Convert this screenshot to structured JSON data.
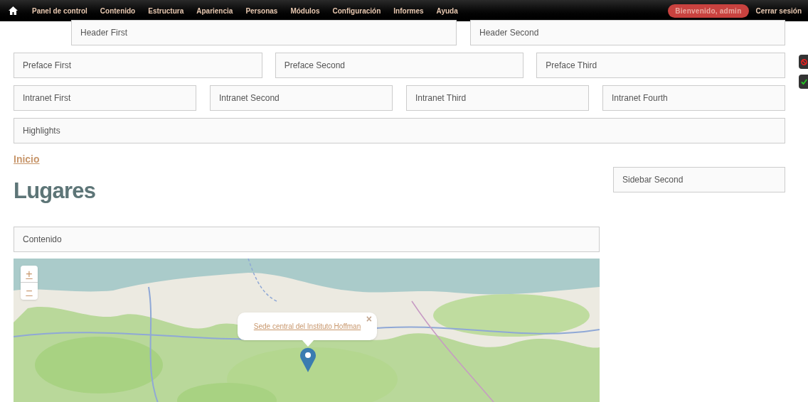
{
  "toolbar": {
    "menu": [
      "Panel de control",
      "Contenido",
      "Estructura",
      "Apariencia",
      "Personas",
      "Módulos",
      "Configuración",
      "Informes",
      "Ayuda"
    ],
    "welcome": "Bienvenido, admin",
    "logout": "Cerrar sesión"
  },
  "header_regions": [
    "Header First",
    "Header Second"
  ],
  "preface_regions": [
    "Preface First",
    "Preface Second",
    "Preface Third"
  ],
  "intranet_regions": [
    "Intranet First",
    "Intranet Second",
    "Intranet Third",
    "Intranet Fourth"
  ],
  "highlights": "Highlights",
  "breadcrumb": "Inicio",
  "page_title": "Lugares",
  "sidebar_region": "Sidebar Second",
  "content_region": "Contenido",
  "map": {
    "zoom_in": "+",
    "zoom_out": "−",
    "popup": {
      "link": "Sede central del Instituto Hoffman",
      "close": "×"
    }
  }
}
